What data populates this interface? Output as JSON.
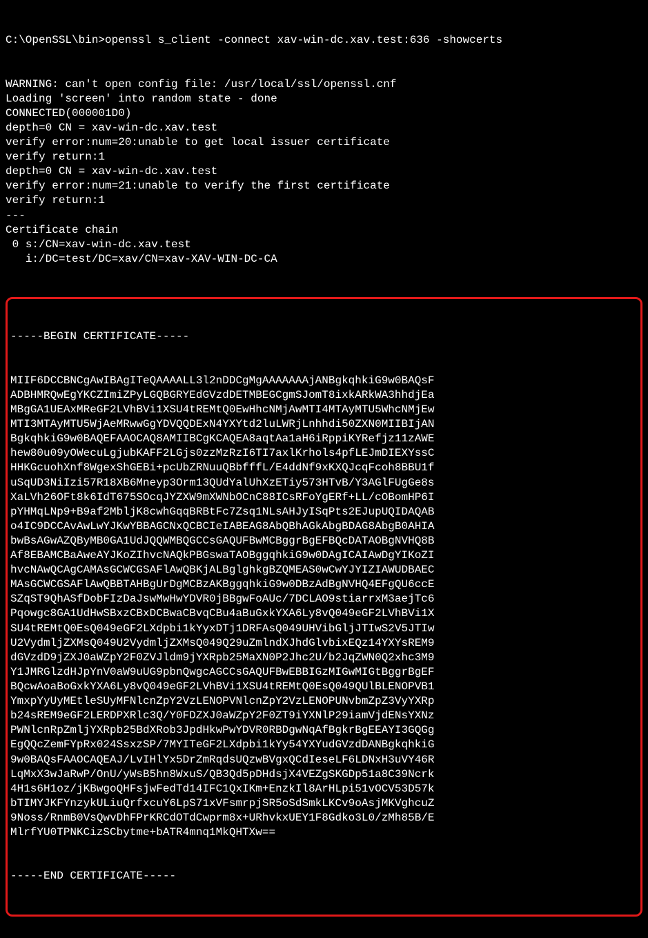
{
  "prompt_path": "C:\\OpenSSL\\bin>",
  "command": "openssl s_client -connect xav-win-dc.xav.test:636 -showcerts",
  "preamble": [
    "WARNING: can't open config file: /usr/local/ssl/openssl.cnf",
    "Loading 'screen' into random state - done",
    "CONNECTED(000001D0)",
    "depth=0 CN = xav-win-dc.xav.test",
    "verify error:num=20:unable to get local issuer certificate",
    "verify return:1",
    "depth=0 CN = xav-win-dc.xav.test",
    "verify error:num=21:unable to verify the first certificate",
    "verify return:1",
    "---",
    "Certificate chain",
    " 0 s:/CN=xav-win-dc.xav.test",
    "   i:/DC=test/DC=xav/CN=xav-XAV-WIN-DC-CA"
  ],
  "cert": {
    "begin": "-----BEGIN CERTIFICATE-----",
    "body": [
      "MIIF6DCCBNCgAwIBAgITeQAAAALL3l2nDDCgMgAAAAAAAjANBgkqhkiG9w0BAQsF",
      "ADBHMRQwEgYKCZImiZPyLGQBGRYEdGVzdDETMBEGCgmSJomT8ixkARkWA3hhdjEa",
      "MBgGA1UEAxMReGF2LVhBVi1XSU4tREMtQ0EwHhcNMjAwMTI4MTAyMTU5WhcNMjEw",
      "MTI3MTAyMTU5WjAeMRwwGgYDVQQDExN4YXYtd2luLWRjLnhhdi50ZXN0MIIBIjAN",
      "BgkqhkiG9w0BAQEFAAOCAQ8AMIIBCgKCAQEA8aqtAa1aH6iRppiKYRefjz11zAWE",
      "hew80u09yOWecuLgjubKAFF2LGjs0zzMzRzI6TI7axlKrhols4pfLEJmDIEXYssC",
      "HHKGcuohXnf8WgexShGEBi+pcUbZRNuuQBbfffL/E4ddNf9xKXQJcqFcoh8BBU1f",
      "uSqUD3NiIzi57R18XB6Mneyp3Orm13QUdYalUhXzETiy573HTvB/Y3AGlFUgGe8s",
      "XaLVh26OFt8k6IdT675SOcqJYZXW9mXWNbOCnC88ICsRFoYgERf+LL/cOBomHP6I",
      "pYHMqLNp9+B9af2MbljK8cwhGqqBRBtFc7Zsq1NLsAHJyISqPts2EJupUQIDAQAB",
      "o4IC9DCCAvAwLwYJKwYBBAGCNxQCBCIeIABEAG8AbQBhAGkAbgBDAG8AbgB0AHIA",
      "bwBsAGwAZQByMB0GA1UdJQQWMBQGCCsGAQUFBwMCBggrBgEFBQcDATAOBgNVHQ8B",
      "Af8EBAMCBaAweAYJKoZIhvcNAQkPBGswaTAOBggqhkiG9w0DAgICAIAwDgYIKoZI",
      "hvcNAwQCAgCAMAsGCWCGSAFlAwQBKjALBglghkgBZQMEAS0wCwYJYIZIAWUDBAEC",
      "MAsGCWCGSAFlAwQBBTAHBgUrDgMCBzAKBggqhkiG9w0DBzAdBgNVHQ4EFgQU6ccE",
      "SZqST9QhASfDobFIzDaJswMwHwYDVR0jBBgwFoAUc/7DCLAO9stiarrxM3aejTc6",
      "Pqowgc8GA1UdHwSBxzCBxDCBwaCBvqCBu4aBuGxkYXA6Ly8vQ049eGF2LVhBVi1X",
      "SU4tREMtQ0EsQ049eGF2LXdpbi1kYyxDTj1DRFAsQ049UHVibGljJTIwS2V5JTIw",
      "U2VydmljZXMsQ049U2VydmljZXMsQ049Q29uZmlndXJhdGlvbixEQz14YXYsREM9",
      "dGVzdD9jZXJ0aWZpY2F0ZVJldm9jYXRpb25MaXN0P2Jhc2U/b2JqZWN0Q2xhc3M9",
      "Y1JMRGlzdHJpYnV0aW9uUG9pbnQwgcAGCCsGAQUFBwEBBIGzMIGwMIGtBggrBgEF",
      "BQcwAoaBoGxkYXA6Ly8vQ049eGF2LVhBVi1XSU4tREMtQ0EsQ049QUlBLENOPVB1",
      "YmxpYyUyMEtleSUyMFNlcnZpY2VzLENOPVNlcnZpY2VzLENOPUNvbmZpZ3VyYXRp",
      "b24sREM9eGF2LERDPXRlc3Q/Y0FDZXJ0aWZpY2F0ZT9iYXNlP29iamVjdENsYXNz",
      "PWNlcnRpZmljYXRpb25BdXRob3JpdHkwPwYDVR0RBDgwNqAfBgkrBgEEAYI3GQGg",
      "EgQQcZemFYpRx024SsxzSP/7MYITeGF2LXdpbi1kYy54YXYudGVzdDANBgkqhkiG",
      "9w0BAQsFAAOCAQEAJ/LvIHlYx5DrZmRqdsUQzwBVgxQCdIeseLF6LDNxH3uVY46R",
      "LqMxX3wJaRwP/OnU/yWsB5hn8WxuS/QB3Qd5pDHdsjX4VEZgSKGDp51a8C39Ncrk",
      "4H1s6H1oz/jKBwgoQHFsjwFedTd14IFC1QxIKm+EnzkIl8ArHLpi51vOCV53D57k",
      "bTIMYJKFYnzykULiuQrfxcuY6LpS71xVFsmrpjSR5oSdSmkLKCv9oAsjMKVghcuZ",
      "9Noss/RnmB0VsQwvDhFPrKRCdOTdCwprm8x+URhvkxUEY1F8Gdko3L0/zMh85B/E",
      "MlrfYU0TPNKCizSCbytme+bATR4mnq1MkQHTXw=="
    ],
    "end": "-----END CERTIFICATE-----"
  }
}
